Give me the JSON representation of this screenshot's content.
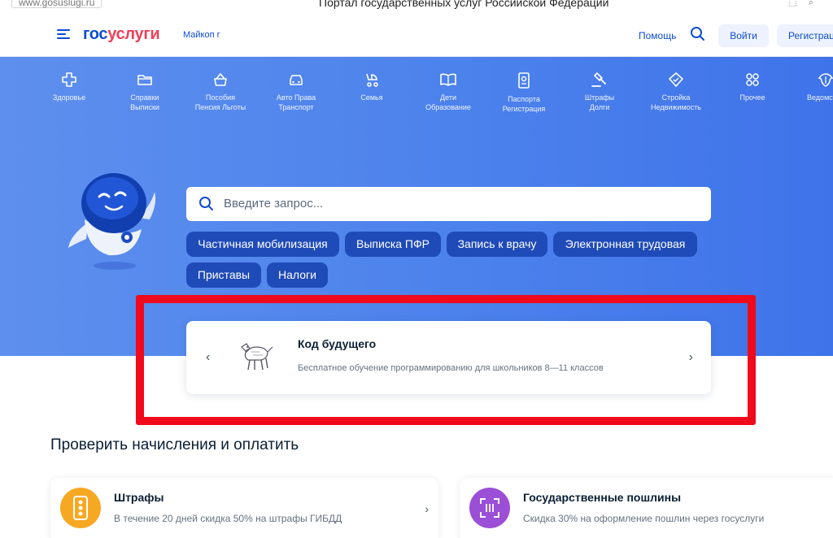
{
  "browser": {
    "url": "www.gosuslugi.ru",
    "window_title": "Портал государственных услуг Российской Федерации"
  },
  "header": {
    "logo_part1": "гос",
    "logo_part2": "услуги",
    "location": "Майкоп г",
    "help": "Помощь",
    "login": "Войти",
    "register": "Регистрация"
  },
  "categories": [
    {
      "icon": "plus-cross-icon",
      "line1": "Здоровье",
      "line2": ""
    },
    {
      "icon": "folder-icon",
      "line1": "Справки",
      "line2": "Выписки"
    },
    {
      "icon": "wallet-icon",
      "line1": "Пособия",
      "line2": "Пенсия Льготы"
    },
    {
      "icon": "car-icon",
      "line1": "Авто Права",
      "line2": "Транспорт"
    },
    {
      "icon": "stroller-icon",
      "line1": "Семья",
      "line2": ""
    },
    {
      "icon": "book-icon",
      "line1": "Дети",
      "line2": "Образование"
    },
    {
      "icon": "passport-icon",
      "line1": "Паспорта",
      "line2": "Регистрация"
    },
    {
      "icon": "gavel-icon",
      "line1": "Штрафы",
      "line2": "Долги"
    },
    {
      "icon": "house-icon",
      "line1": "Стройка",
      "line2": "Недвижимость"
    },
    {
      "icon": "grid-icon",
      "line1": "Прочее",
      "line2": ""
    },
    {
      "icon": "emblem-icon",
      "line1": "Ведомства",
      "line2": ""
    }
  ],
  "search": {
    "placeholder": "Введите запрос..."
  },
  "chips": [
    "Частичная мобилизация",
    "Выписка ПФР",
    "Запись к врачу",
    "Электронная трудовая",
    "Приставы",
    "Налоги"
  ],
  "banner": {
    "title": "Код будущего",
    "description": "Бесплатное обучение программированию для школьников 8—11 классов",
    "prev": "‹",
    "next": "›"
  },
  "section": {
    "title": "Проверить начисления и оплатить"
  },
  "cards": [
    {
      "title": "Штрафы",
      "description": "В течение 20 дней скидка 50% на штрафы ГИБДД",
      "icon_color": "#f7a823",
      "arrow": "›"
    },
    {
      "title": "Государственные пошлины",
      "description": "Скидка 30% на оформление пошлин через госуслуги",
      "icon_color": "#9b4fd6"
    }
  ]
}
